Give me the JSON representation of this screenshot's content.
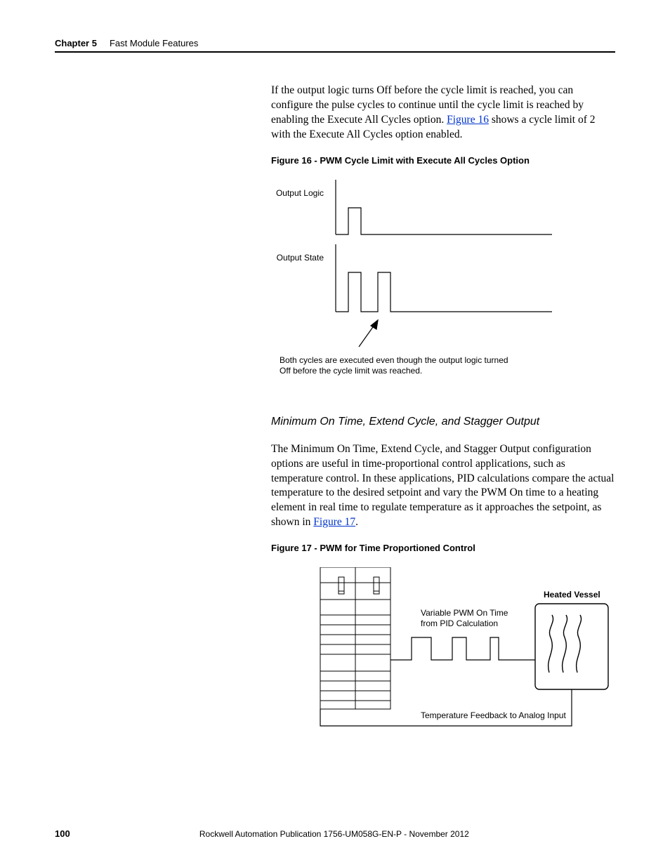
{
  "header": {
    "chapter": "Chapter 5",
    "title": "Fast Module Features"
  },
  "paragraphs": {
    "p1_a": "If the output logic turns Off before the cycle limit is reached, you can configure the pulse cycles to continue until the cycle limit is reached by enabling the Execute All Cycles option. ",
    "p1_link": "Figure 16",
    "p1_b": " shows a cycle limit of 2 with the Execute All Cycles option enabled.",
    "p2_a": "The Minimum On Time, Extend Cycle, and Stagger Output configuration options are useful in time-proportional control applications, such as temperature control. In these applications, PID calculations compare the actual temperature to the desired setpoint and vary the PWM On time to a heating element in real time to regulate temperature as it approaches the setpoint, as shown in ",
    "p2_link": "Figure 17",
    "p2_b": "."
  },
  "figure16": {
    "caption": "Figure 16 - PWM Cycle Limit with Execute All Cycles Option",
    "label_logic": "Output Logic",
    "label_state": "Output State",
    "note": "Both cycles are executed even though the output logic turned Off before the cycle limit was reached."
  },
  "section_heading": "Minimum On Time, Extend Cycle, and Stagger Output",
  "figure17": {
    "caption": "Figure 17 - PWM for Time Proportioned Control",
    "label_vessel": "Heated Vessel",
    "label_pwm_l1": "Variable PWM On Time",
    "label_pwm_l2": "from PID Calculation",
    "label_feedback": "Temperature Feedback to Analog Input"
  },
  "footer": {
    "page": "100",
    "publication": "Rockwell Automation Publication 1756-UM058G-EN-P - November 2012"
  }
}
